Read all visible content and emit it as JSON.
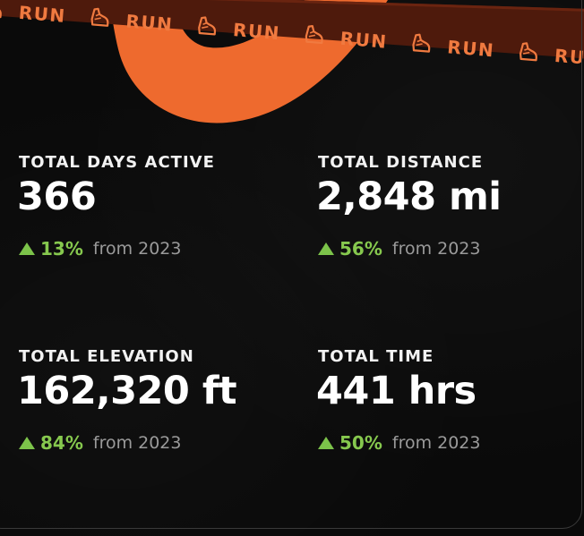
{
  "banner": {
    "word": "RUN",
    "icon": "running-shoe-icon",
    "accent_color": "#ee6a2e",
    "ribbon_color": "#4e1a0c",
    "ribbon_text_color": "#f07a40"
  },
  "stats": [
    {
      "label": "TOTAL DAYS ACTIVE",
      "value": "366",
      "change": "13%",
      "comparison": "from 2023"
    },
    {
      "label": "TOTAL DISTANCE",
      "value": "2,848 mi",
      "change": "56%",
      "comparison": "from 2023"
    },
    {
      "label": "TOTAL ELEVATION",
      "value": "162,320 ft",
      "change": "84%",
      "comparison": "from 2023"
    },
    {
      "label": "TOTAL TIME",
      "value": "441 hrs",
      "change": "50%",
      "comparison": "from 2023"
    }
  ],
  "colors": {
    "background": "#0a0a0a",
    "positive": "#86c84e",
    "muted_text": "#9a9a9a",
    "primary_text": "#ffffff"
  }
}
